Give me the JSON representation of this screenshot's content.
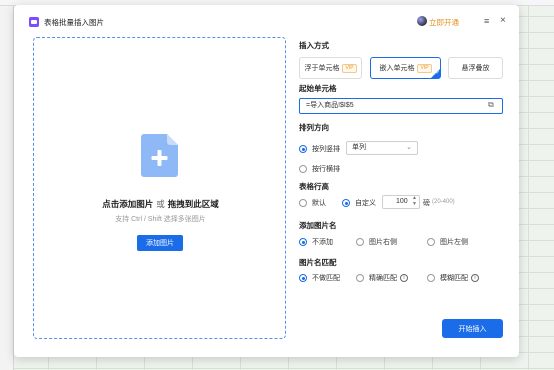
{
  "dialog": {
    "title": "表格批量插入图片",
    "vip_link": "立即开通",
    "menu_icon": "menu-icon",
    "close_icon": "close-icon"
  },
  "dropzone": {
    "main_text_1": "点击添加图片",
    "main_or": "或",
    "main_text_2": "拖拽到此区域",
    "sub_text": "支持 Ctrl / Shift 选择多张图片",
    "add_button": "添加图片"
  },
  "insert_mode": {
    "label": "插入方式",
    "options": [
      {
        "label": "浮于单元格",
        "vip": "VIP",
        "selected": false
      },
      {
        "label": "嵌入单元格",
        "vip": "VIP",
        "selected": true
      },
      {
        "label": "悬浮叠放",
        "vip": "",
        "selected": false
      }
    ]
  },
  "start_cell": {
    "label": "起始单元格",
    "value": "=导入商品!$I$5"
  },
  "order": {
    "label": "排列方向",
    "opt1": "按列竖排",
    "select_value": "单列",
    "opt2": "按行横排"
  },
  "row_height": {
    "label": "表格行高",
    "opt_default": "默认",
    "opt_custom": "自定义",
    "value": "100",
    "unit": "磅",
    "range": "(20-400)"
  },
  "image_name": {
    "label": "添加图片名",
    "opts": [
      "不添加",
      "图片右侧",
      "图片左侧"
    ]
  },
  "name_match": {
    "label": "图片名匹配",
    "opts": [
      "不做匹配",
      "精确匹配",
      "模糊匹配"
    ]
  },
  "start_button": "开始插入",
  "colors": {
    "accent": "#1a6ce8",
    "vip": "#e4901a",
    "dashed": "#5b8def"
  }
}
